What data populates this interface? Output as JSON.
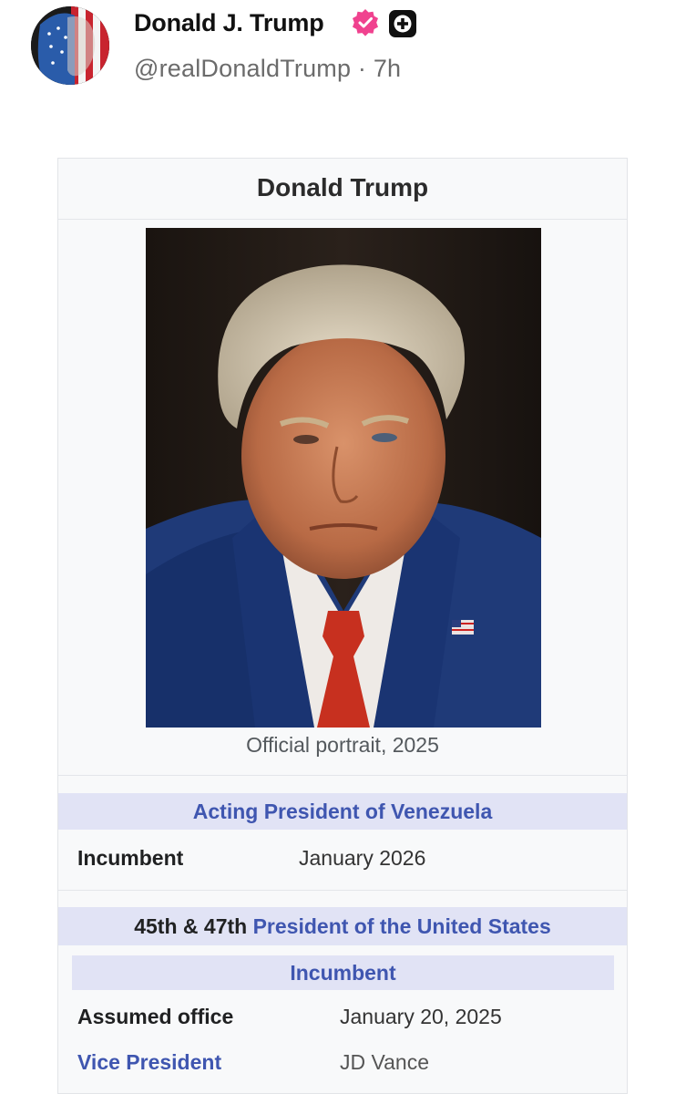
{
  "post": {
    "author_name": "Donald J. Trump",
    "handle": "@realDonaldTrump",
    "separator": "·",
    "time_ago": "7h",
    "verified_color": "#f0428f"
  },
  "infobox": {
    "title": "Donald Trump",
    "portrait_caption": "Official portrait, 2025",
    "office1": {
      "heading": "Acting President of Venezuela",
      "rows": [
        {
          "label": "Incumbent",
          "value": "January 2026"
        }
      ]
    },
    "office2": {
      "ordinal": "45th & 47th",
      "heading": "President of the United States",
      "status": "Incumbent",
      "rows": [
        {
          "label": "Assumed office",
          "value": "January 20, 2025"
        },
        {
          "label": "Vice President",
          "value": "JD Vance"
        }
      ]
    },
    "link_color": "#3f56b0",
    "band_color": "#e1e3f5"
  }
}
